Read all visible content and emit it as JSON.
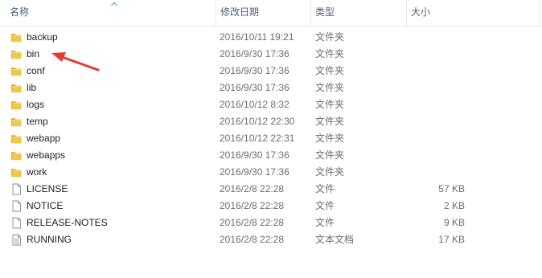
{
  "columns": {
    "name": "名称",
    "date": "修改日期",
    "type": "类型",
    "size": "大小"
  },
  "colors": {
    "folder": "#f2c744",
    "folder_dark": "#d9a520",
    "annotation": "#e53a2e",
    "header_text": "#4c607a"
  },
  "files": [
    {
      "name": "backup",
      "date": "2016/10/11 19:21",
      "type": "文件夹",
      "size": "",
      "icon": "folder-icon"
    },
    {
      "name": "bin",
      "date": "2016/9/30 17:36",
      "type": "文件夹",
      "size": "",
      "icon": "folder-icon"
    },
    {
      "name": "conf",
      "date": "2016/9/30 17:36",
      "type": "文件夹",
      "size": "",
      "icon": "folder-icon"
    },
    {
      "name": "lib",
      "date": "2016/9/30 17:36",
      "type": "文件夹",
      "size": "",
      "icon": "folder-icon"
    },
    {
      "name": "logs",
      "date": "2016/10/12 8:32",
      "type": "文件夹",
      "size": "",
      "icon": "folder-icon"
    },
    {
      "name": "temp",
      "date": "2016/10/12 22:30",
      "type": "文件夹",
      "size": "",
      "icon": "folder-icon"
    },
    {
      "name": "webapp",
      "date": "2016/10/12 22:31",
      "type": "文件夹",
      "size": "",
      "icon": "folder-icon"
    },
    {
      "name": "webapps",
      "date": "2016/9/30 17:36",
      "type": "文件夹",
      "size": "",
      "icon": "folder-icon"
    },
    {
      "name": "work",
      "date": "2016/9/30 17:36",
      "type": "文件夹",
      "size": "",
      "icon": "folder-icon"
    },
    {
      "name": "LICENSE",
      "date": "2016/2/8 22:28",
      "type": "文件",
      "size": "57 KB",
      "icon": "file-icon"
    },
    {
      "name": "NOTICE",
      "date": "2016/2/8 22:28",
      "type": "文件",
      "size": "2 KB",
      "icon": "file-icon"
    },
    {
      "name": "RELEASE-NOTES",
      "date": "2016/2/8 22:28",
      "type": "文件",
      "size": "9 KB",
      "icon": "file-icon"
    },
    {
      "name": "RUNNING",
      "date": "2016/2/8 22:28",
      "type": "文本文档",
      "size": "17 KB",
      "icon": "text-document-icon"
    }
  ]
}
